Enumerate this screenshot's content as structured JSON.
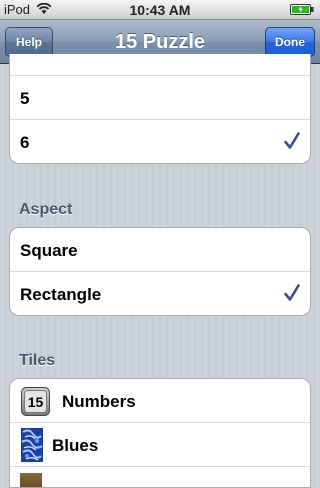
{
  "status": {
    "carrier": "iPod",
    "time": "10:43 AM"
  },
  "nav": {
    "title": "15 Puzzle",
    "left_button": "Help",
    "right_button": "Done"
  },
  "size_options": [
    {
      "label": "5",
      "checked": false
    },
    {
      "label": "6",
      "checked": true
    }
  ],
  "aspect": {
    "header": "Aspect",
    "options": [
      {
        "label": "Square",
        "checked": false
      },
      {
        "label": "Rectangle",
        "checked": true
      }
    ]
  },
  "tiles": {
    "header": "Tiles",
    "numbers_icon_text": "15",
    "options": [
      {
        "label": "Numbers",
        "icon": "numbers-tile-icon"
      },
      {
        "label": "Blues",
        "icon": "blues-image-icon"
      }
    ]
  },
  "colors": {
    "check": "#385487",
    "nav_blue": "#6d84a2",
    "done_blue": "#2566dc"
  }
}
